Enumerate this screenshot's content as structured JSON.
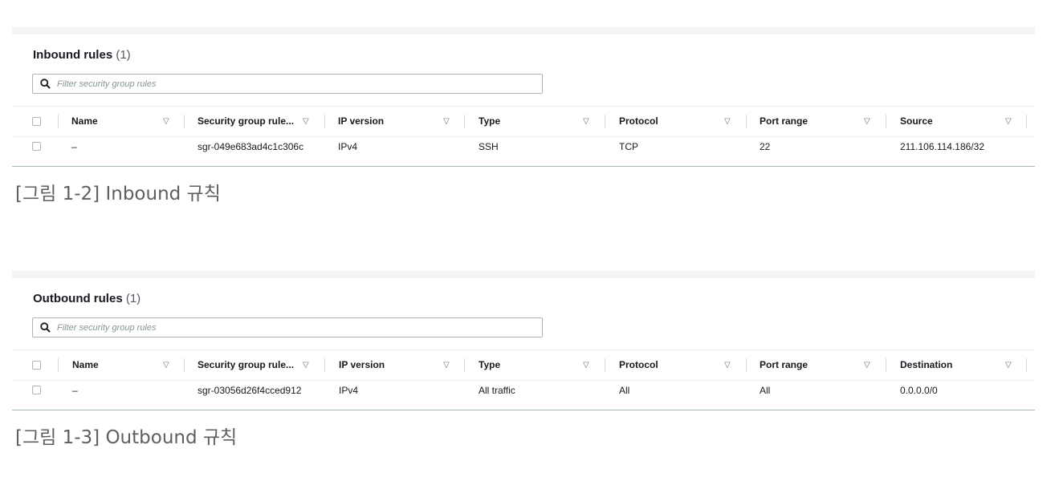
{
  "inbound": {
    "title": "Inbound rules",
    "count": "(1)",
    "filter_placeholder": "Filter security group rules",
    "columns": [
      "Name",
      "Security group rule...",
      "IP version",
      "Type",
      "Protocol",
      "Port range",
      "Source"
    ],
    "sort_icon": "▽",
    "row": {
      "name": "–",
      "rule_id": "sgr-049e683ad4c1c306c",
      "ip_version": "IPv4",
      "type": "SSH",
      "protocol": "TCP",
      "port_range": "22",
      "source": "211.106.114.186/32"
    },
    "caption": "[그림 1-2] Inbound 규칙"
  },
  "outbound": {
    "title": "Outbound rules",
    "count": "(1)",
    "filter_placeholder": "Filter security group rules",
    "columns": [
      "Name",
      "Security group rule...",
      "IP version",
      "Type",
      "Protocol",
      "Port range",
      "Destination"
    ],
    "sort_icon": "▽",
    "row": {
      "name": "–",
      "rule_id": "sgr-03056d26f4cced912",
      "ip_version": "IPv4",
      "type": "All traffic",
      "protocol": "All",
      "port_range": "All",
      "destination": "0.0.0.0/0"
    },
    "caption": "[그림 1-3] Outbound 규칙"
  }
}
